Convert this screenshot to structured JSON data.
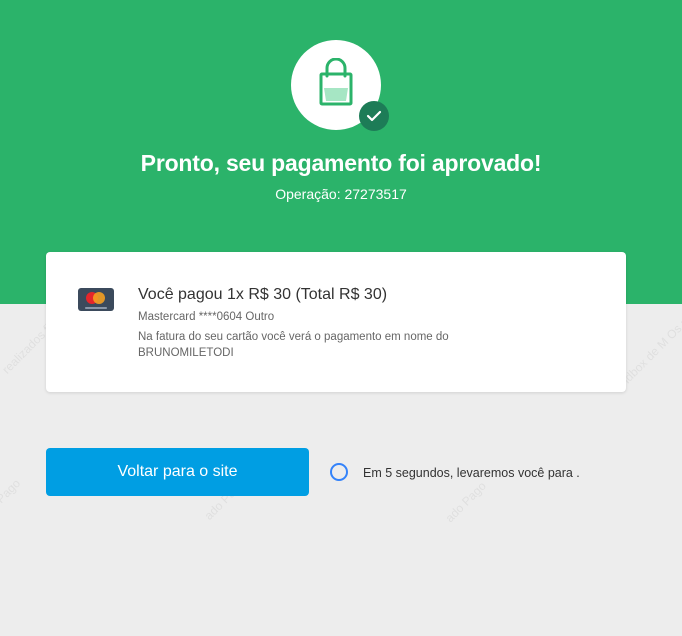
{
  "header": {
    "title": "Pronto, seu pagamento foi aprovado!",
    "operation": "Operação: 27273517",
    "icons": [
      "shopping-bag-icon",
      "check-icon"
    ],
    "colors": {
      "background": "#2bb36a",
      "badge": "#1d7c57"
    }
  },
  "payment": {
    "card_brand_icon": "mastercard-icon",
    "summary": "Você pagou 1x R$ 30 (Total R$ 30)",
    "card_info": "Mastercard ****0604 Outro",
    "statement_note": "Na fatura do seu cartão você verá o pagamento em nome do BRUNOMILETODI"
  },
  "actions": {
    "back_label": "Voltar para o site",
    "redirect_text": "Em 5 segundos, levaremos você para .",
    "colors": {
      "button": "#009ee3",
      "timer": "#3483fa"
    }
  }
}
